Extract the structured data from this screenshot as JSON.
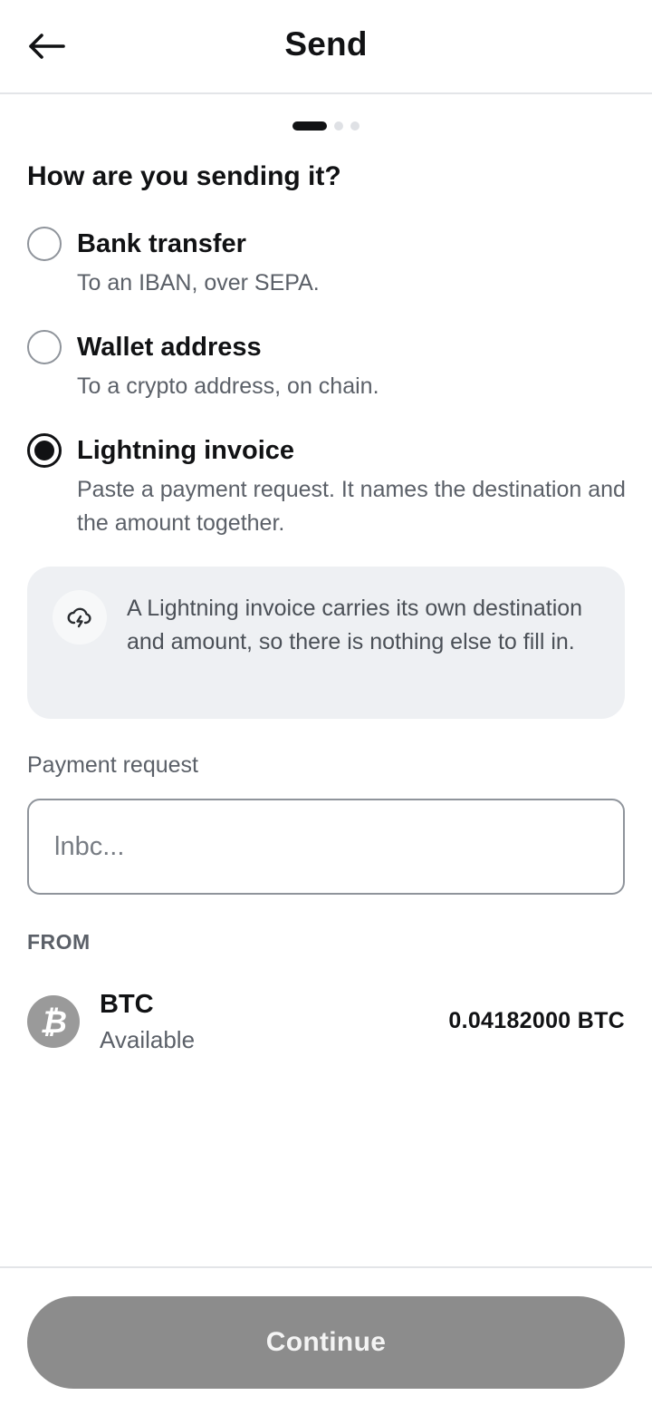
{
  "header": {
    "title": "Send",
    "back_icon": "arrow-left-icon"
  },
  "stepper": {
    "total_steps": 3,
    "current_step": 1
  },
  "method": {
    "question": "How are you sending it?",
    "options": [
      {
        "label": "Bank transfer",
        "description": "To an IBAN, over SEPA.",
        "selected": false
      },
      {
        "label": "Wallet address",
        "description": "To a crypto address, on chain.",
        "selected": false
      },
      {
        "label": "Lightning invoice",
        "description": "Paste a payment request. It names the destination and the amount together.",
        "selected": true
      }
    ]
  },
  "info": {
    "icon": "lightning-cloud-icon",
    "text": "A Lightning invoice carries its own destination and amount, so there is nothing else to fill in."
  },
  "payment_request": {
    "label": "Payment request",
    "placeholder": "lnbc...",
    "value": ""
  },
  "from": {
    "label": "FROM",
    "account": {
      "icon": "bitcoin-icon",
      "name": "BTC",
      "sublabel": "Available",
      "balance": "0.04182000 BTC"
    }
  },
  "footer": {
    "continue_label": "Continue",
    "continue_enabled": false
  },
  "colors": {
    "primary_text": "#111214",
    "secondary_text": "#5b6068",
    "info_background": "#eef0f3",
    "disabled_button": "#8c8c8c",
    "coin_avatar": "#9a9a9a"
  }
}
